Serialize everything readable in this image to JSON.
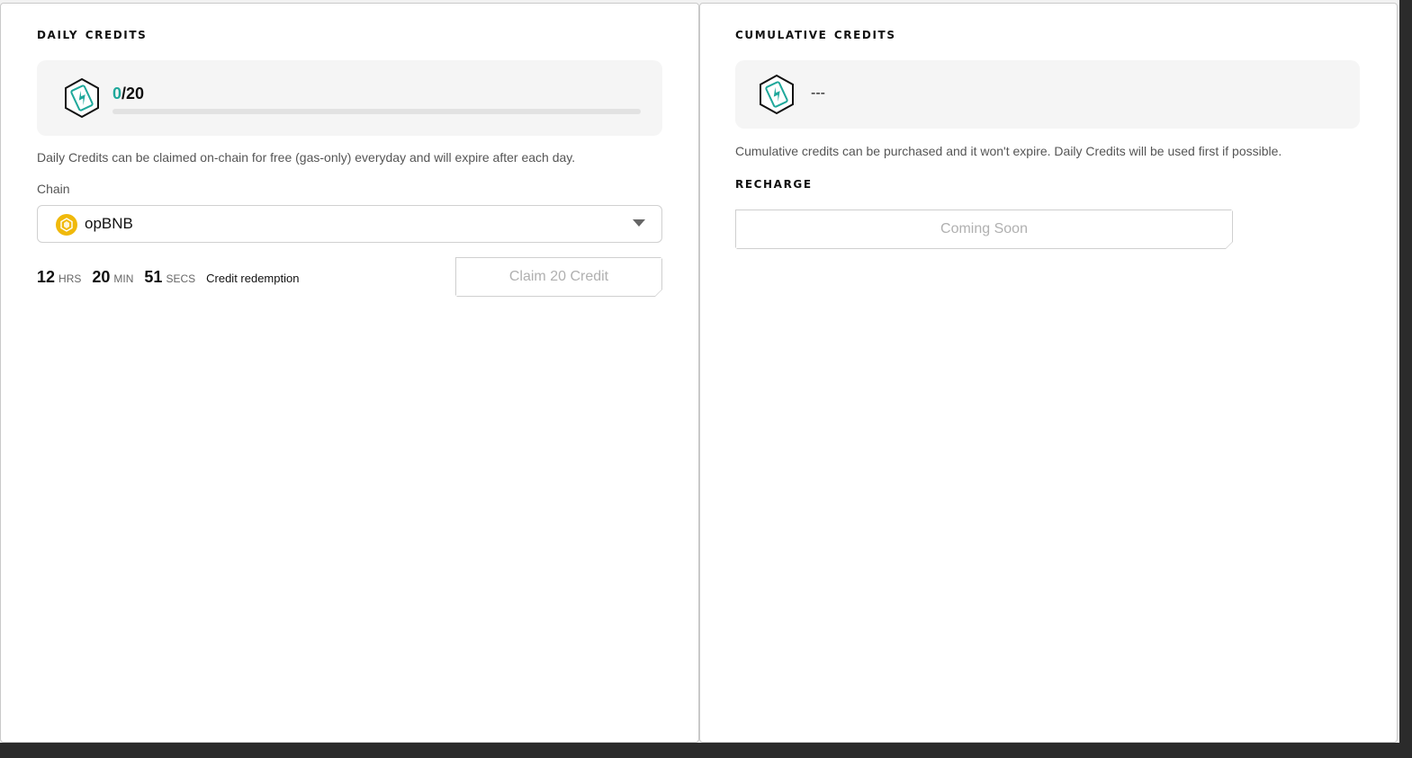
{
  "daily": {
    "title": "Daily Credits",
    "current": "0",
    "total": "/20",
    "progress_fraction": 0,
    "description": "Daily Credits can be claimed on-chain for free (gas-only) everyday and will expire after each day.",
    "chain_label": "Chain",
    "chain_value": "opBNB",
    "chain_icon": "bnb-coin-icon",
    "timer": {
      "hrs": "12",
      "hrs_unit": "HRS",
      "min": "20",
      "min_unit": "MIN",
      "secs": "51",
      "secs_unit": "SECS",
      "note": "Credit redemption"
    },
    "claim_label": "Claim 20 Credit"
  },
  "cumulative": {
    "title": "Cumulative Credits",
    "value": "---",
    "description": "Cumulative credits can be purchased and it won't expire. Daily Credits will be used first if possible.",
    "recharge_title": "Recharge",
    "recharge_button": "Coming Soon"
  },
  "colors": {
    "accent": "#1fa89b",
    "bnb": "#f0b90b",
    "disabled_text": "#b0b0b0"
  }
}
